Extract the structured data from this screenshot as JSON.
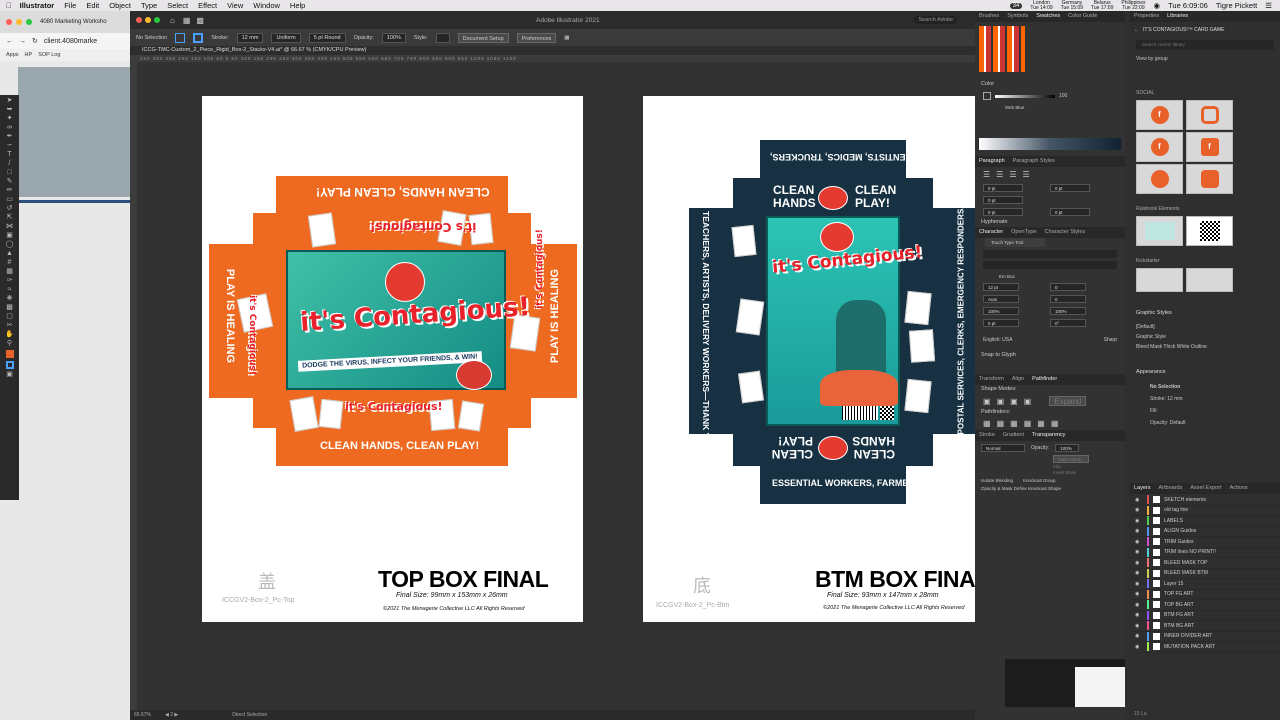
{
  "menubar": {
    "app": "Illustrator",
    "items": [
      "File",
      "Edit",
      "Object",
      "Type",
      "Select",
      "Effect",
      "View",
      "Window",
      "Help"
    ],
    "clocks": [
      {
        "city": "London",
        "time": "Tue 14:09"
      },
      {
        "city": "Germany",
        "time": "Tue 15:09"
      },
      {
        "city": "Belarus",
        "time": "Tue 17:09"
      },
      {
        "city": "Philippines",
        "time": "Tue 22:09"
      }
    ],
    "battery": "34",
    "datetime": "Tue 6:09:06",
    "user": "Tigre Pickett"
  },
  "browser": {
    "tab_title": "4080 Marketing Worksho",
    "address": "client.4080marke",
    "bookmarks": [
      "Apps",
      "HP",
      "SOP Log"
    ]
  },
  "ai": {
    "window_title": "Adobe Illustrator 2021",
    "doc_tab": "ICCG-TMC-Custom_2_Piece_Rigid_Box-2_Stacks-V4.ai* @ 66.67 % (CMYK/CPU Preview)",
    "search_placeholder": "Search Adobe"
  },
  "control": {
    "selection": "No Selection",
    "stroke_label": "Stroke:",
    "stroke_value": "12 mm",
    "profile": "Uniform",
    "brush": "5 pt Round",
    "opacity_label": "Opacity:",
    "opacity_value": "100%",
    "style_label": "Style:",
    "doc_setup": "Document Setup",
    "prefs": "Preferences"
  },
  "ruler": "350 300 250 200 150 100 50 0 50 100 150 200 250 300 350 400 450 500 550 600 650 700 750 800 850 900 950 1000 1050 1100",
  "boxes": {
    "top": {
      "flap": "CLEAN HANDS, CLEAN PLAY!",
      "side": "PLAY IS HEALING",
      "logo": "it's Contagious!",
      "tagline": "DODGE THE VIRUS, INFECT YOUR FRIENDS, & WIN!",
      "title": "TOP BOX FINAL",
      "size": "Final Size: 99mm x 153mm x 26mm",
      "copy": "©2021 The Menagerie Collective LLC All Rights Reserved",
      "cn": "盖",
      "file": "ICCGV2-Box-2_Pc-Top"
    },
    "btm": {
      "top_flap": "SCIENTISTS, MEDICS, TRUCKERS,",
      "left_side": "TEACHERS, ARTISTS, DELIVERY WORKERS—THANK YOU!",
      "right_side": "POSTAL SERVICES, CLERKS, EMERGENCY RESPONDERS,",
      "bottom_flap": "ESSENTIAL WORKERS, FARMERS,",
      "clean1": "CLEAN HANDS",
      "clean2": "CLEAN PLAY!",
      "logo": "it's Contagious!",
      "title": "BTM BOX FINAL",
      "size": "Final Size: 93mm x 147mm x 28mm",
      "copy": "©2021 The Menagerie Collective LLC All Rights Reserved",
      "cn": "底",
      "file": "ICCGV2-Box-2_Pc-Btm"
    }
  },
  "panels": {
    "top_tabs": [
      "Brushes",
      "Symbols",
      "Swatches",
      "Color Guide"
    ],
    "color_tab": "Color",
    "color_value": "100",
    "web_label": "Web Blue",
    "para_tabs": [
      "Paragraph",
      "Paragraph Styles"
    ],
    "para_values": [
      "0 pt",
      "0 pt",
      "0 pt",
      "0 pt",
      "0 pt"
    ],
    "hyphenate": "Hyphenate",
    "char_tabs": [
      "Character",
      "OpenType",
      "Character Styles"
    ],
    "touch": "Touch Type Tool",
    "em_box": "Em Box",
    "char_values": [
      "12 pt",
      "Auto",
      "100%",
      "100%",
      "0 pt",
      "0°",
      "0",
      "0"
    ],
    "lang": "English: USA",
    "sharp": "Sharp",
    "snap": "Snap to Glyph",
    "path_tabs": [
      "Transform",
      "Align",
      "Pathfinder"
    ],
    "shape_modes": "Shape Modes:",
    "pathfinders": "Pathfinders:",
    "expand": "Expand",
    "trans_tabs": [
      "Stroke",
      "Gradient",
      "Transparency"
    ],
    "blend": "Normal",
    "opacity_label": "Opacity:",
    "opacity": "100%",
    "make_mask": "Make Mask",
    "clip": "Clip",
    "invert": "Invert Mask",
    "isolate": "Isolate Blending",
    "knockout": "Knockout Group",
    "opacity_mask": "Opacity & Mask Define Knockout Shape"
  },
  "libraries": {
    "tabs": [
      "Properties",
      "Libraries"
    ],
    "lib_name": "IT'S CONTAGIOUS!™ CARD GAME",
    "search": "Search current library",
    "view_by": "View by group",
    "groups": [
      "SOCIAL",
      "Rulebook Elements",
      "Kickstarter"
    ],
    "gstyles_title": "Graphic Styles",
    "gstyles": [
      "[Default]",
      "Graphic Style",
      "Bleed Mask Thick White Outline"
    ],
    "appearance_title": "Appearance",
    "app_sel": "No Selection",
    "app_stroke": "Stroke:",
    "app_stroke_val": "12 mm",
    "app_fill": "Fill:",
    "app_opacity": "Opacity: Default"
  },
  "layers": {
    "tabs": [
      "Layers",
      "Artboards",
      "Asset Export",
      "Actions"
    ],
    "rows": [
      "SKETCH elements",
      "old tag line",
      "LABELS",
      "ALIGN Guides",
      "TRIM Guides",
      "TRIM lines NO PRINT!!",
      "BLEED MASK TOP",
      "BLEED MASK BTM",
      "Layer 15",
      "TOP FG ART",
      "TOP BG ART",
      "BTM FG ART",
      "BTM BG ART",
      "INNER DIVIDER ART",
      "MUTATION PACK ART"
    ],
    "colors": [
      "#e05050",
      "#f0b040",
      "#50d050",
      "#5090f0",
      "#d050d0",
      "#50d0d0",
      "#f07070",
      "#d0d050",
      "#7070f0",
      "#f09050",
      "#50f090",
      "#9050f0",
      "#f05090",
      "#50a0f0",
      "#a0f050"
    ],
    "footer": "15 La"
  },
  "status": {
    "zoom": "66.67%",
    "page": "2",
    "tool": "Direct Selection"
  }
}
